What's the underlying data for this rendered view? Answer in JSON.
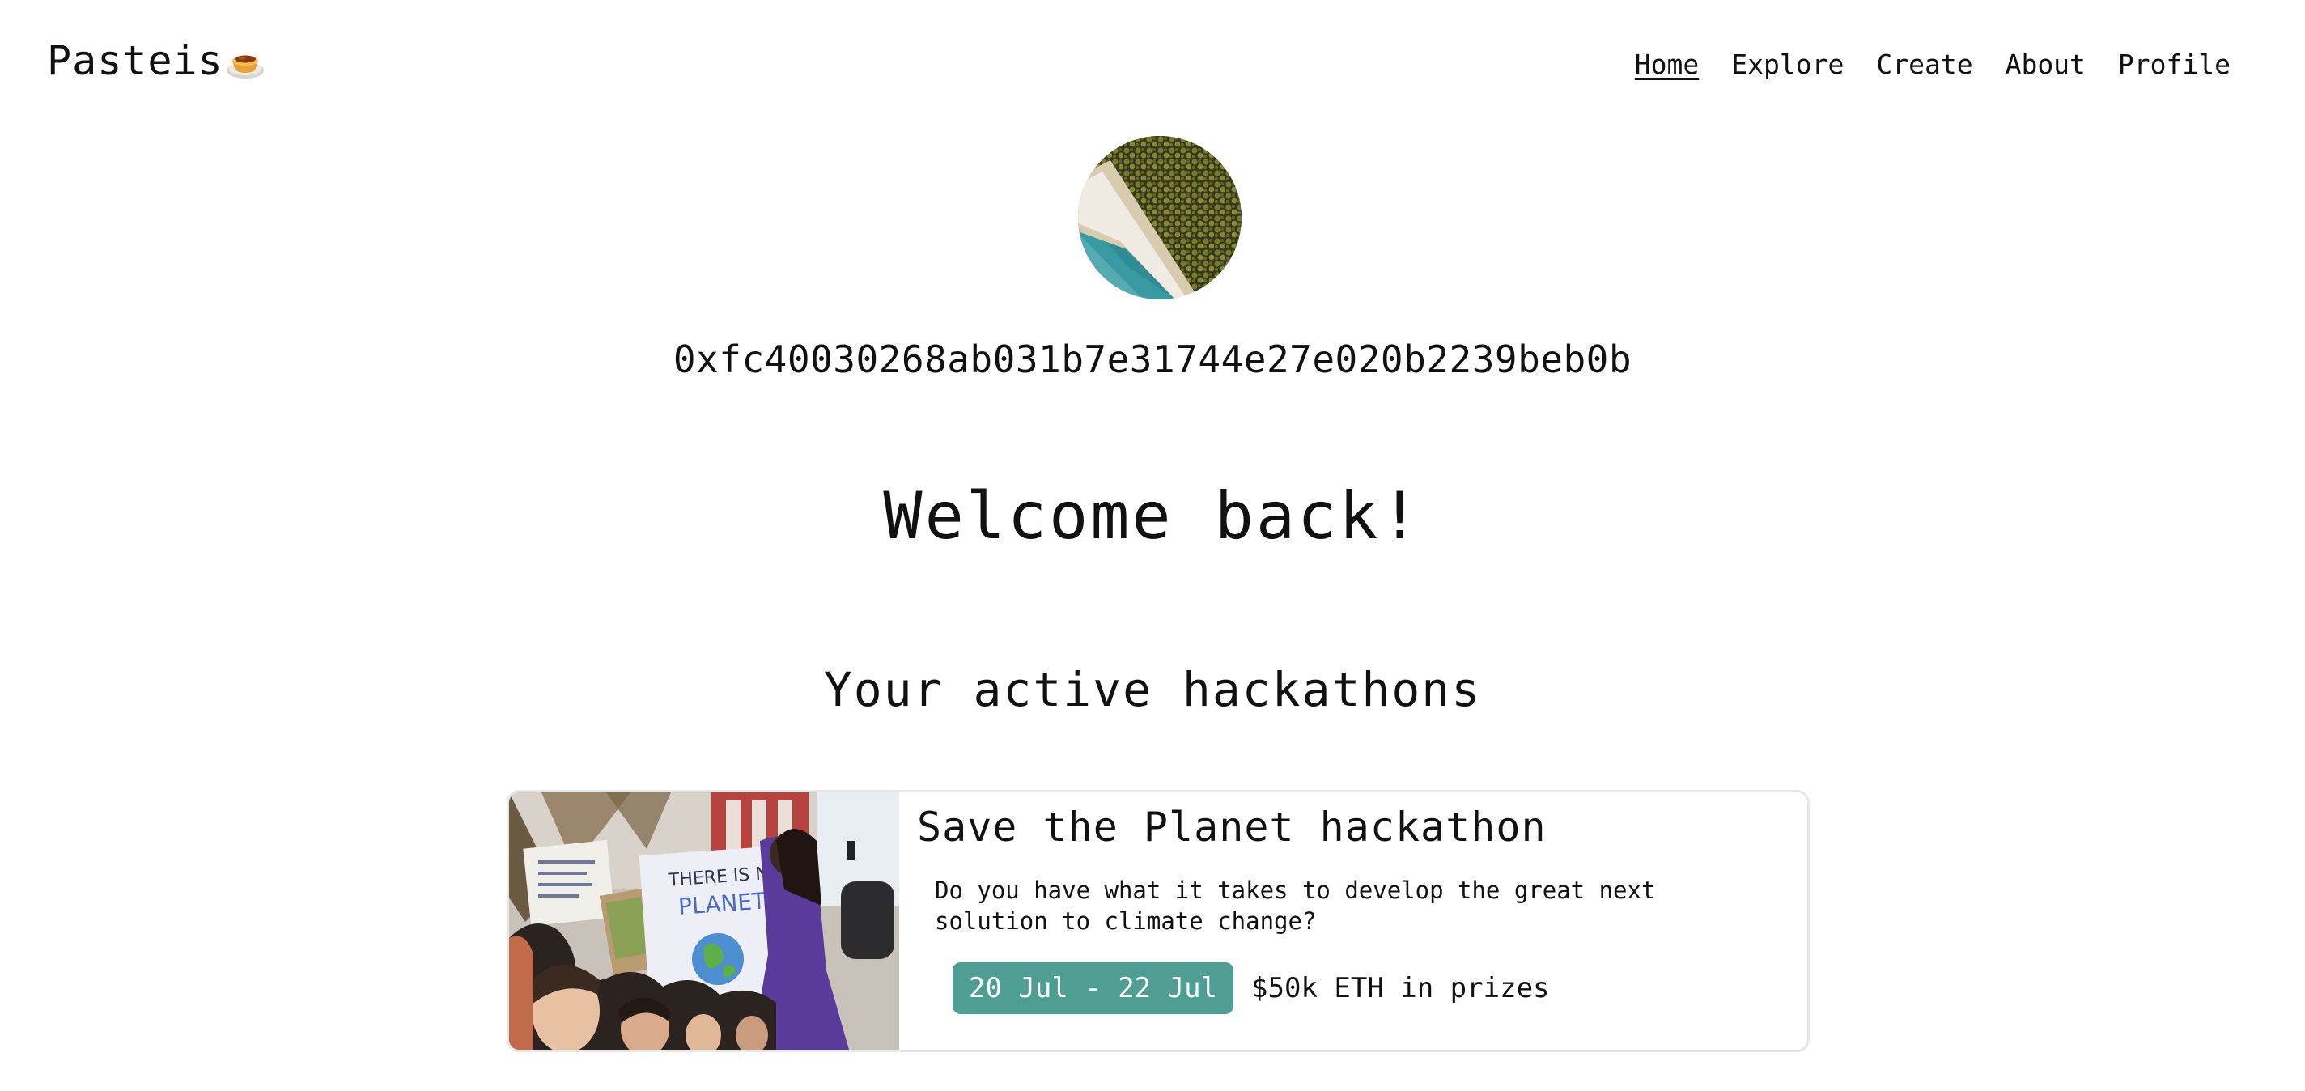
{
  "header": {
    "logo_text": "Pasteis",
    "logo_icon": "pastel-de-nata-icon",
    "nav": [
      {
        "label": "Home",
        "active": true
      },
      {
        "label": "Explore",
        "active": false
      },
      {
        "label": "Create",
        "active": false
      },
      {
        "label": "About",
        "active": false
      },
      {
        "label": "Profile",
        "active": false
      }
    ]
  },
  "profile": {
    "avatar": "aerial-beach-forest-avatar",
    "address": "0xfc40030268ab031b7e31744e27e020b2239beb0b"
  },
  "main": {
    "welcome": "Welcome back!",
    "section_title": "Your active hackathons",
    "hackathons": [
      {
        "title": "Save the Planet hackathon",
        "description": "Do you have what it takes to develop the great next solution to climate change?",
        "dates": "20 Jul - 22 Jul",
        "prize": "$50k ETH in prizes",
        "image": "climate-protest-photo",
        "sign_text": "THERE IS NO PLANET B"
      }
    ]
  },
  "colors": {
    "accent": "#4e9e93",
    "text": "#111111",
    "card_border": "#e7e7e7",
    "background": "#ffffff"
  }
}
